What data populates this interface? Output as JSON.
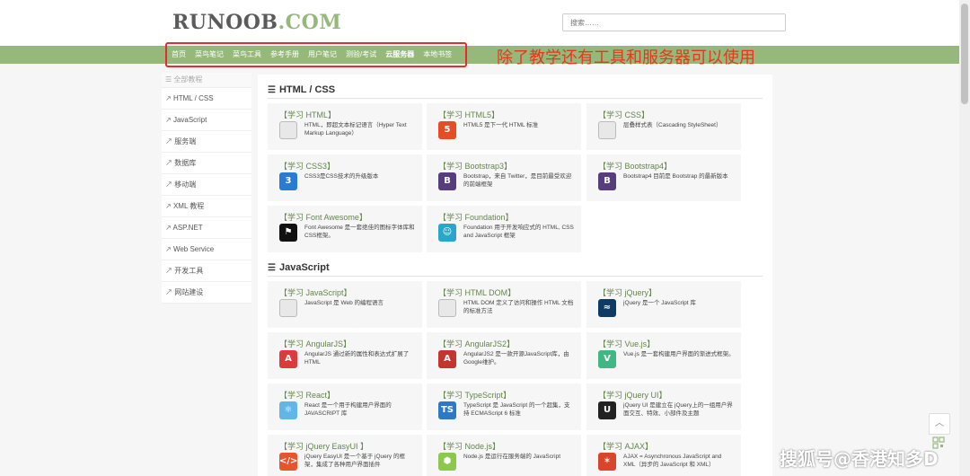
{
  "header": {
    "logo_left": "RUNOOB",
    "logo_right": ".COM",
    "search_placeholder": "搜索……"
  },
  "nav": {
    "items": [
      {
        "label": "首页",
        "bold": false
      },
      {
        "label": "菜鸟笔记",
        "bold": false
      },
      {
        "label": "菜鸟工具",
        "bold": false
      },
      {
        "label": "参考手册",
        "bold": false
      },
      {
        "label": "用户笔记",
        "bold": false
      },
      {
        "label": "测验/考试",
        "bold": false
      },
      {
        "label": "云服务器",
        "bold": true
      },
      {
        "label": "本地书签",
        "bold": false
      }
    ]
  },
  "annotation": "除了教学还有工具和服务器可以使用",
  "sidebar": {
    "header": "全部教程",
    "items": [
      "HTML / CSS",
      "JavaScript",
      "服务端",
      "数据库",
      "移动端",
      "XML 教程",
      "ASP.NET",
      "Web Service",
      "开发工具",
      "网站建设"
    ]
  },
  "sections": [
    {
      "title": "HTML / CSS",
      "cards": [
        {
          "title": "【学习 HTML】",
          "desc": "HTML，即超文本标记语言（Hyper Text Markup Language）",
          "icon": "html-doc-icon",
          "icon_text": "",
          "color": "#e8e8e8"
        },
        {
          "title": "【学习 HTML5】",
          "desc": "HTML5 是下一代 HTML 标准",
          "icon": "html5-icon",
          "icon_text": "5",
          "color": "#e44d26"
        },
        {
          "title": "【学习 CSS】",
          "desc": "层叠样式表（Cascading StyleSheet）",
          "icon": "css-doc-icon",
          "icon_text": "",
          "color": "#e8e8e8"
        },
        {
          "title": "【学习 CSS3】",
          "desc": "CSS3是CSS技术的升级版本",
          "icon": "css3-icon",
          "icon_text": "3",
          "color": "#2a7bd4"
        },
        {
          "title": "【学习 Bootstrap3】",
          "desc": "Bootstrap，来自 Twitter，是目前最受欢迎的前端框架",
          "icon": "bootstrap-icon",
          "icon_text": "B",
          "color": "#563d7c"
        },
        {
          "title": "【学习 Bootstrap4】",
          "desc": "Bootstrap4 目前是 Bootstrap 的最新版本",
          "icon": "bootstrap4-icon",
          "icon_text": "B",
          "color": "#563d7c"
        },
        {
          "title": "【学习 Font Awesome】",
          "desc": "Font Awesome 是一套绝佳的图标字体库和CSS框架。",
          "icon": "flag-icon",
          "icon_text": "⚑",
          "color": "#111111"
        },
        {
          "title": "【学习 Foundation】",
          "desc": "Foundation 用于开发响应式的 HTML, CSS and JavaScript 框架",
          "icon": "foundation-icon",
          "icon_text": "☺",
          "color": "#2ba6cb"
        }
      ]
    },
    {
      "title": "JavaScript",
      "cards": [
        {
          "title": "【学习 JavaScript】",
          "desc": "JavaScript 是 Web 的编程语言",
          "icon": "js-doc-icon",
          "icon_text": "",
          "color": "#e8e8e8"
        },
        {
          "title": "【学习 HTML DOM】",
          "desc": "HTML DOM 定义了访问和操作 HTML 文档的标准方法",
          "icon": "dom-doc-icon",
          "icon_text": "",
          "color": "#e8e8e8"
        },
        {
          "title": "【学习 jQuery】",
          "desc": "jQuery 是一个 JavaScript 库",
          "icon": "jquery-icon",
          "icon_text": "≈",
          "color": "#0d3b66"
        },
        {
          "title": "【学习 AngularJS】",
          "desc": "AngularJS 通过新的属性和表达式扩展了 HTML",
          "icon": "angularjs-icon",
          "icon_text": "A",
          "color": "#dd3b3b"
        },
        {
          "title": "【学习 AngularJS2】",
          "desc": "AngularJS2 是一款开源JavaScript库，由Google维护。",
          "icon": "angular2-icon",
          "icon_text": "A",
          "color": "#c3352e"
        },
        {
          "title": "【学习 Vue.js】",
          "desc": "Vue.js 是一套构建用户界面的渐进式框架。",
          "icon": "vue-icon",
          "icon_text": "V",
          "color": "#41b883"
        },
        {
          "title": "【学习 React】",
          "desc": "React 是一个用于构建用户界面的 JAVASCRIPT 库",
          "icon": "react-icon",
          "icon_text": "⚛",
          "color": "#61b6e8"
        },
        {
          "title": "【学习 TypeScript】",
          "desc": "TypeScript 是 JavaScript 的一个超集，支持 ECMAScript 6 标准",
          "icon": "typescript-icon",
          "icon_text": "TS",
          "color": "#2d79c7"
        },
        {
          "title": "【学习 jQuery UI】",
          "desc": "jQuery UI 是建立在 jQuery上的一组用户界面交互、特效、小部件及主题",
          "icon": "jqueryui-icon",
          "icon_text": "U",
          "color": "#222222"
        },
        {
          "title": "【学习 jQuery EasyUI 】",
          "desc": "jQuery EasyUI 是一个基于 jQuery 的框架，集成了各种用户界面插件",
          "icon": "easyui-icon",
          "icon_text": "</>",
          "color": "#e6552d"
        },
        {
          "title": "【学习 Node.js】",
          "desc": "Node.js 是运行在服务端的 JavaScript",
          "icon": "nodejs-icon",
          "icon_text": "⬢",
          "color": "#8cc84b"
        },
        {
          "title": "【学习 AJAX】",
          "desc": "AJAX = Asynchronous JavaScript and XML（异步的 JavaScript 和 XML）",
          "icon": "ajax-icon",
          "icon_text": "✶",
          "color": "#d9452b"
        }
      ]
    }
  ],
  "watermark": "搜狐号@香港知多D"
}
